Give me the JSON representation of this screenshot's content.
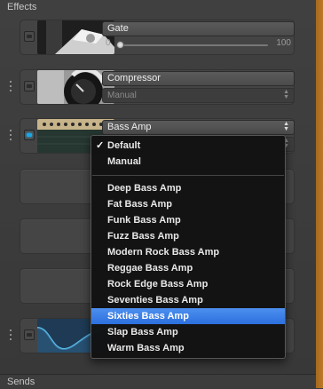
{
  "sections": {
    "effects": "Effects",
    "sends": "Sends"
  },
  "gate": {
    "name": "Gate",
    "slider_min": "0",
    "slider_max": "100",
    "slider_value": 0
  },
  "compressor": {
    "name": "Compressor",
    "preset": "Manual"
  },
  "bass_amp": {
    "name": "Bass Amp",
    "power_on": true
  },
  "preset_menu": {
    "top_items": [
      {
        "label": "Default",
        "checked": true
      },
      {
        "label": "Manual",
        "checked": false
      }
    ],
    "items": [
      {
        "label": "Deep Bass Amp",
        "selected": false
      },
      {
        "label": "Fat Bass Amp",
        "selected": false
      },
      {
        "label": "Funk Bass Amp",
        "selected": false
      },
      {
        "label": "Fuzz Bass Amp",
        "selected": false
      },
      {
        "label": "Modern Rock Bass Amp",
        "selected": false
      },
      {
        "label": "Reggae Bass Amp",
        "selected": false
      },
      {
        "label": "Rock Edge Bass Amp",
        "selected": false
      },
      {
        "label": "Seventies Bass Amp",
        "selected": false
      },
      {
        "label": "Sixties Bass Amp",
        "selected": true
      },
      {
        "label": "Slap Bass Amp",
        "selected": false
      },
      {
        "label": "Warm Bass Amp",
        "selected": false
      }
    ]
  },
  "icons": {
    "handle": "drag-handle-icon",
    "power": "power-button-icon",
    "check": "checkmark-icon",
    "updown": "updown-arrows-icon"
  },
  "colors": {
    "led_on": "#1aa7e8",
    "menu_highlight": "#2c6fde",
    "side_strip": "#c07828"
  }
}
